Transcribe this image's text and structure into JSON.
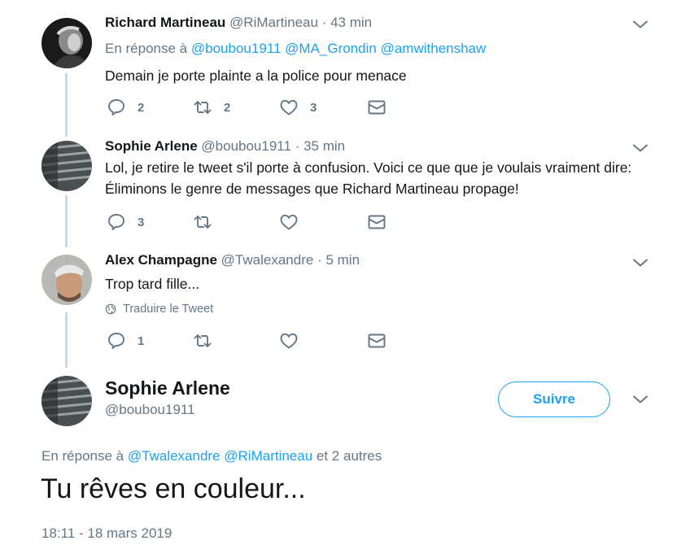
{
  "tweets": [
    {
      "name": "Richard Martineau",
      "handle": "@RiMartineau",
      "dot": "·",
      "time": "43 min",
      "reply_prefix": "En réponse à",
      "reply_to": [
        "@boubou1911",
        "@MA_Grondin",
        "@amwithenshaw"
      ],
      "text": "Demain je porte plainte a la police pour menace",
      "replies": "2",
      "retweets": "2",
      "likes": "3"
    },
    {
      "name": "Sophie Arlene",
      "handle": "@boubou1911",
      "dot": "·",
      "time": "35 min",
      "text": "Lol, je retire le tweet s'il porte à confusion. Voici ce que que je voulais vraiment dire: Éliminons le genre de messages que Richard Martineau propage!",
      "replies": "3",
      "retweets": "",
      "likes": ""
    },
    {
      "name": "Alex Champagne",
      "handle": "@Twalexandre",
      "dot": "·",
      "time": "5 min",
      "text": "Trop tard fille...",
      "translate": "Traduire le Tweet",
      "replies": "1",
      "retweets": "",
      "likes": ""
    }
  ],
  "main_tweet": {
    "name": "Sophie Arlene",
    "handle": "@boubou1911",
    "follow_label": "Suivre",
    "reply_prefix": "En réponse à",
    "reply_to": [
      "@Twalexandre",
      "@RiMartineau"
    ],
    "reply_suffix": "et 2 autres",
    "text": "Tu rêves en couleur...",
    "timestamp": "18:11 - 18 mars 2019"
  },
  "icons": {
    "reply": "reply-icon",
    "retweet": "retweet-icon",
    "like": "heart-icon",
    "dm": "envelope-icon",
    "more": "chevron-down-icon",
    "globe": "globe-icon"
  },
  "colors": {
    "link": "#1da1f2",
    "secondary": "#657786",
    "thread_line": "#ccd6dd",
    "text": "#14171a"
  }
}
